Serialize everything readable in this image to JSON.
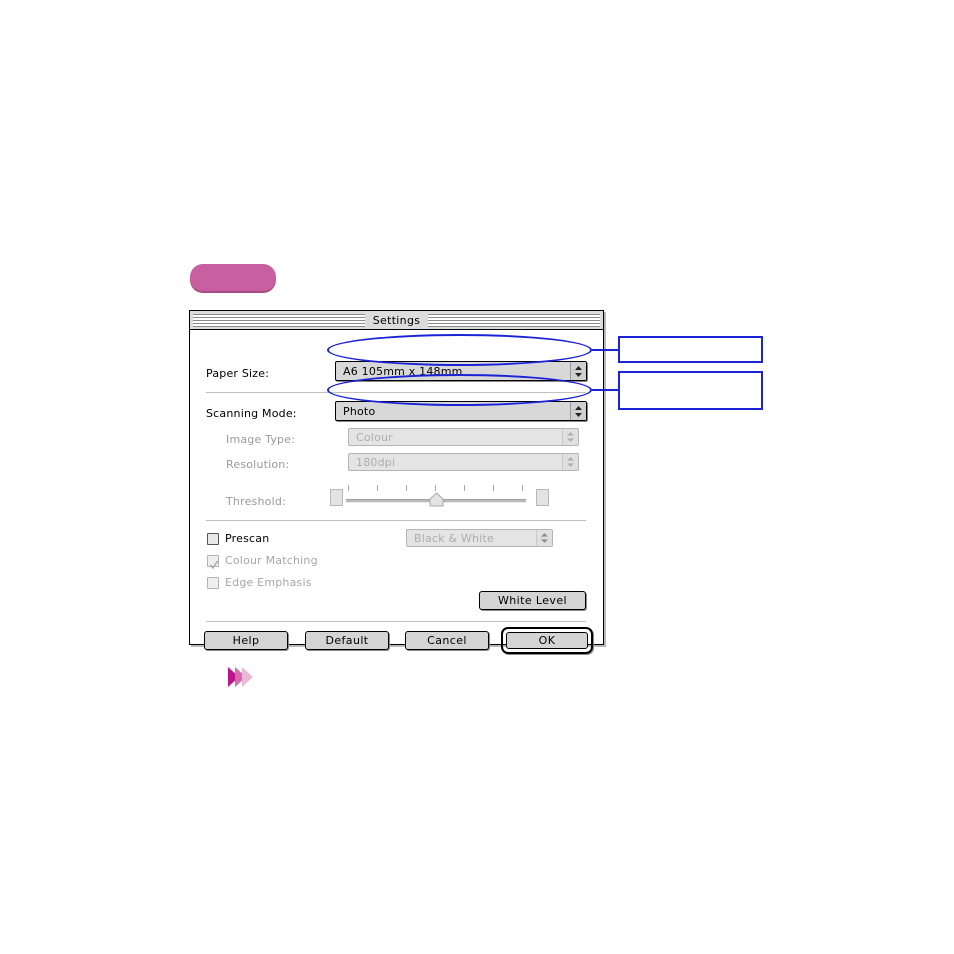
{
  "page": {
    "background_color": "#ffffff",
    "accent_pink": "#c75fa0",
    "annotation_blue": "#1a23d6"
  },
  "pink_tab": {
    "label": "",
    "color": "#c75fa0",
    "shadow_color": "#a84b85"
  },
  "pink_arrow": {
    "name": "triple-chevron",
    "colors": [
      "#c0148c",
      "#d46bb0",
      "#e9b9d6"
    ]
  },
  "dialog": {
    "title": "Settings",
    "rows": [
      {
        "label": "Paper Size:",
        "value": "A6  105mm x 148mm",
        "enabled": true
      },
      {
        "label": "Scanning Mode:",
        "value": "Photo",
        "enabled": true
      },
      {
        "label": "Image Type:",
        "value": "Colour",
        "enabled": false
      },
      {
        "label": "Resolution:",
        "value": "180dpi",
        "enabled": false
      }
    ],
    "threshold": {
      "label": "Threshold:",
      "enabled": false,
      "tick_count": 7,
      "thumb_position_percent": 50
    },
    "checkboxes": [
      {
        "label": "Prescan",
        "checked": false,
        "enabled": true
      },
      {
        "label": "Colour Matching",
        "checked": true,
        "enabled": false
      },
      {
        "label": "Edge Emphasis",
        "checked": false,
        "enabled": false
      }
    ],
    "prescan_popup": {
      "value": "Black & White",
      "enabled": false
    },
    "white_level_button": {
      "label": "White Level"
    },
    "buttons": [
      {
        "label": "Help",
        "default": false
      },
      {
        "label": "Default",
        "default": false
      },
      {
        "label": "Cancel",
        "default": false
      },
      {
        "label": "OK",
        "default": true
      }
    ]
  },
  "annotations": {
    "highlights": [
      {
        "name": "paper-size-highlight",
        "target": "Paper Size:"
      },
      {
        "name": "scanning-mode-highlight",
        "target": "Scanning Mode:"
      }
    ],
    "callouts": [
      {
        "name": "callout-paper-size",
        "text": ""
      },
      {
        "name": "callout-scanning-mode",
        "text": ""
      }
    ]
  }
}
